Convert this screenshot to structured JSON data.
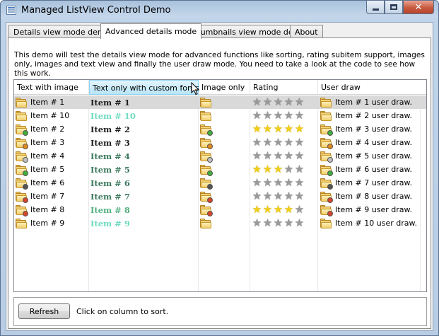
{
  "window": {
    "title": "Managed ListView Control Demo"
  },
  "tabs": [
    {
      "label": "Details view mode demo",
      "active": false
    },
    {
      "label": "Advanced details mode",
      "active": true
    },
    {
      "label": "Thumbnails view mode demo",
      "active": false
    },
    {
      "label": "About",
      "active": false
    }
  ],
  "description": "This demo will test the details view mode for advanced functions like sorting, rating subitem support, images only, images and text view and finally the user draw mode. You need to take a look at the code to see how this work.",
  "listview": {
    "columns": [
      "Text with image",
      "Text only with custom fonts",
      "Image only",
      "Rating",
      "User draw"
    ],
    "sorted_column": "Text only with custom fonts",
    "rows": [
      {
        "text": "Item # 1",
        "custom": "Item # 1",
        "custom_color": "#1e1e1e",
        "rating": 0,
        "user_draw": "Item # 1 user draw.",
        "badge": "none",
        "selected": true
      },
      {
        "text": "Item # 10",
        "custom": "Item # 10",
        "custom_color": "#6fdbbf",
        "rating": 0,
        "user_draw": "Item # 2 user draw.",
        "badge": "none",
        "selected": false
      },
      {
        "text": "Item # 2",
        "custom": "Item # 2",
        "custom_color": "#1e1e1e",
        "rating": 5,
        "user_draw": "Item # 3 user draw.",
        "badge": "green",
        "selected": false
      },
      {
        "text": "Item # 3",
        "custom": "Item # 3",
        "custom_color": "#1e1e1e",
        "rating": 0,
        "user_draw": "Item # 4 user draw.",
        "badge": "orange",
        "selected": false
      },
      {
        "text": "Item # 4",
        "custom": "Item # 4",
        "custom_color": "#3d7a5e",
        "rating": 0,
        "user_draw": "Item # 5 user draw.",
        "badge": "gray",
        "selected": false
      },
      {
        "text": "Item # 5",
        "custom": "Item # 5",
        "custom_color": "#3d7a5e",
        "rating": 3,
        "user_draw": "Item # 6 user draw.",
        "badge": "green",
        "selected": false
      },
      {
        "text": "Item # 6",
        "custom": "Item # 6",
        "custom_color": "#3d7a5e",
        "rating": 0,
        "user_draw": "Item # 7 user draw.",
        "badge": "dark",
        "selected": false
      },
      {
        "text": "Item # 7",
        "custom": "Item # 7",
        "custom_color": "#3d7a5e",
        "rating": 0,
        "user_draw": "Item # 8 user draw.",
        "badge": "red",
        "selected": false
      },
      {
        "text": "Item # 8",
        "custom": "Item # 8",
        "custom_color": "#52b07e",
        "rating": 4,
        "user_draw": "Item # 9 user draw.",
        "badge": "red",
        "selected": false
      },
      {
        "text": "Item # 9",
        "custom": "Item # 9",
        "custom_color": "#6fdbbf",
        "rating": 0,
        "user_draw": "Item # 10 user draw.",
        "badge": "none",
        "selected": false
      }
    ]
  },
  "bottom": {
    "refresh_label": "Refresh",
    "hint": "Click on column to sort."
  },
  "colors": {
    "star_on": "#f2cf17",
    "star_off": "#9a9a9a",
    "header_hot": "#b8e5f8",
    "selected_row": "#d9d9d9"
  }
}
